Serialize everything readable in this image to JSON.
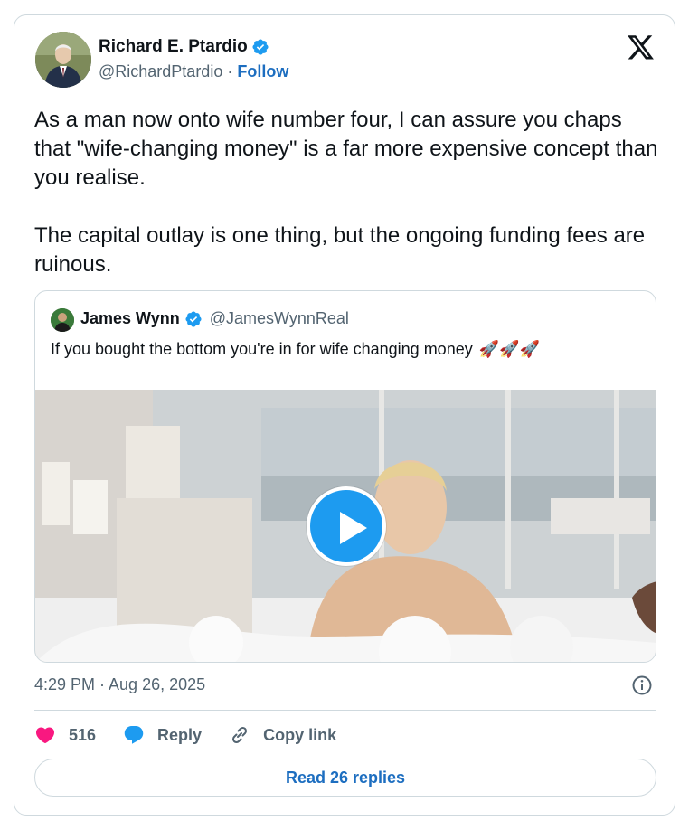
{
  "author": {
    "name": "Richard E. Ptardio",
    "handle": "@RichardPtardio",
    "separator": "·",
    "follow_label": "Follow"
  },
  "tweet": {
    "text": "As a man now onto wife number four, I can assure you chaps that \"wife-changing money\" is a far more expensive concept than you realise.\n\nThe capital outlay is one thing, but the ongoing funding fees are ruinous.",
    "timestamp": "4:29 PM · Aug 26, 2025"
  },
  "quoted": {
    "name": "James Wynn",
    "handle": "@JamesWynnReal",
    "text": "If you bought the bottom you're in for wife changing money",
    "emoji": "🚀🚀🚀"
  },
  "actions": {
    "like_count": "516",
    "reply_label": "Reply",
    "copy_label": "Copy link"
  },
  "read_replies_label": "Read 26 replies",
  "colors": {
    "accent": "#1d9bf0",
    "link": "#1d6ec0",
    "like": "#f91880",
    "muted": "#536471",
    "border": "#cfd9de"
  }
}
